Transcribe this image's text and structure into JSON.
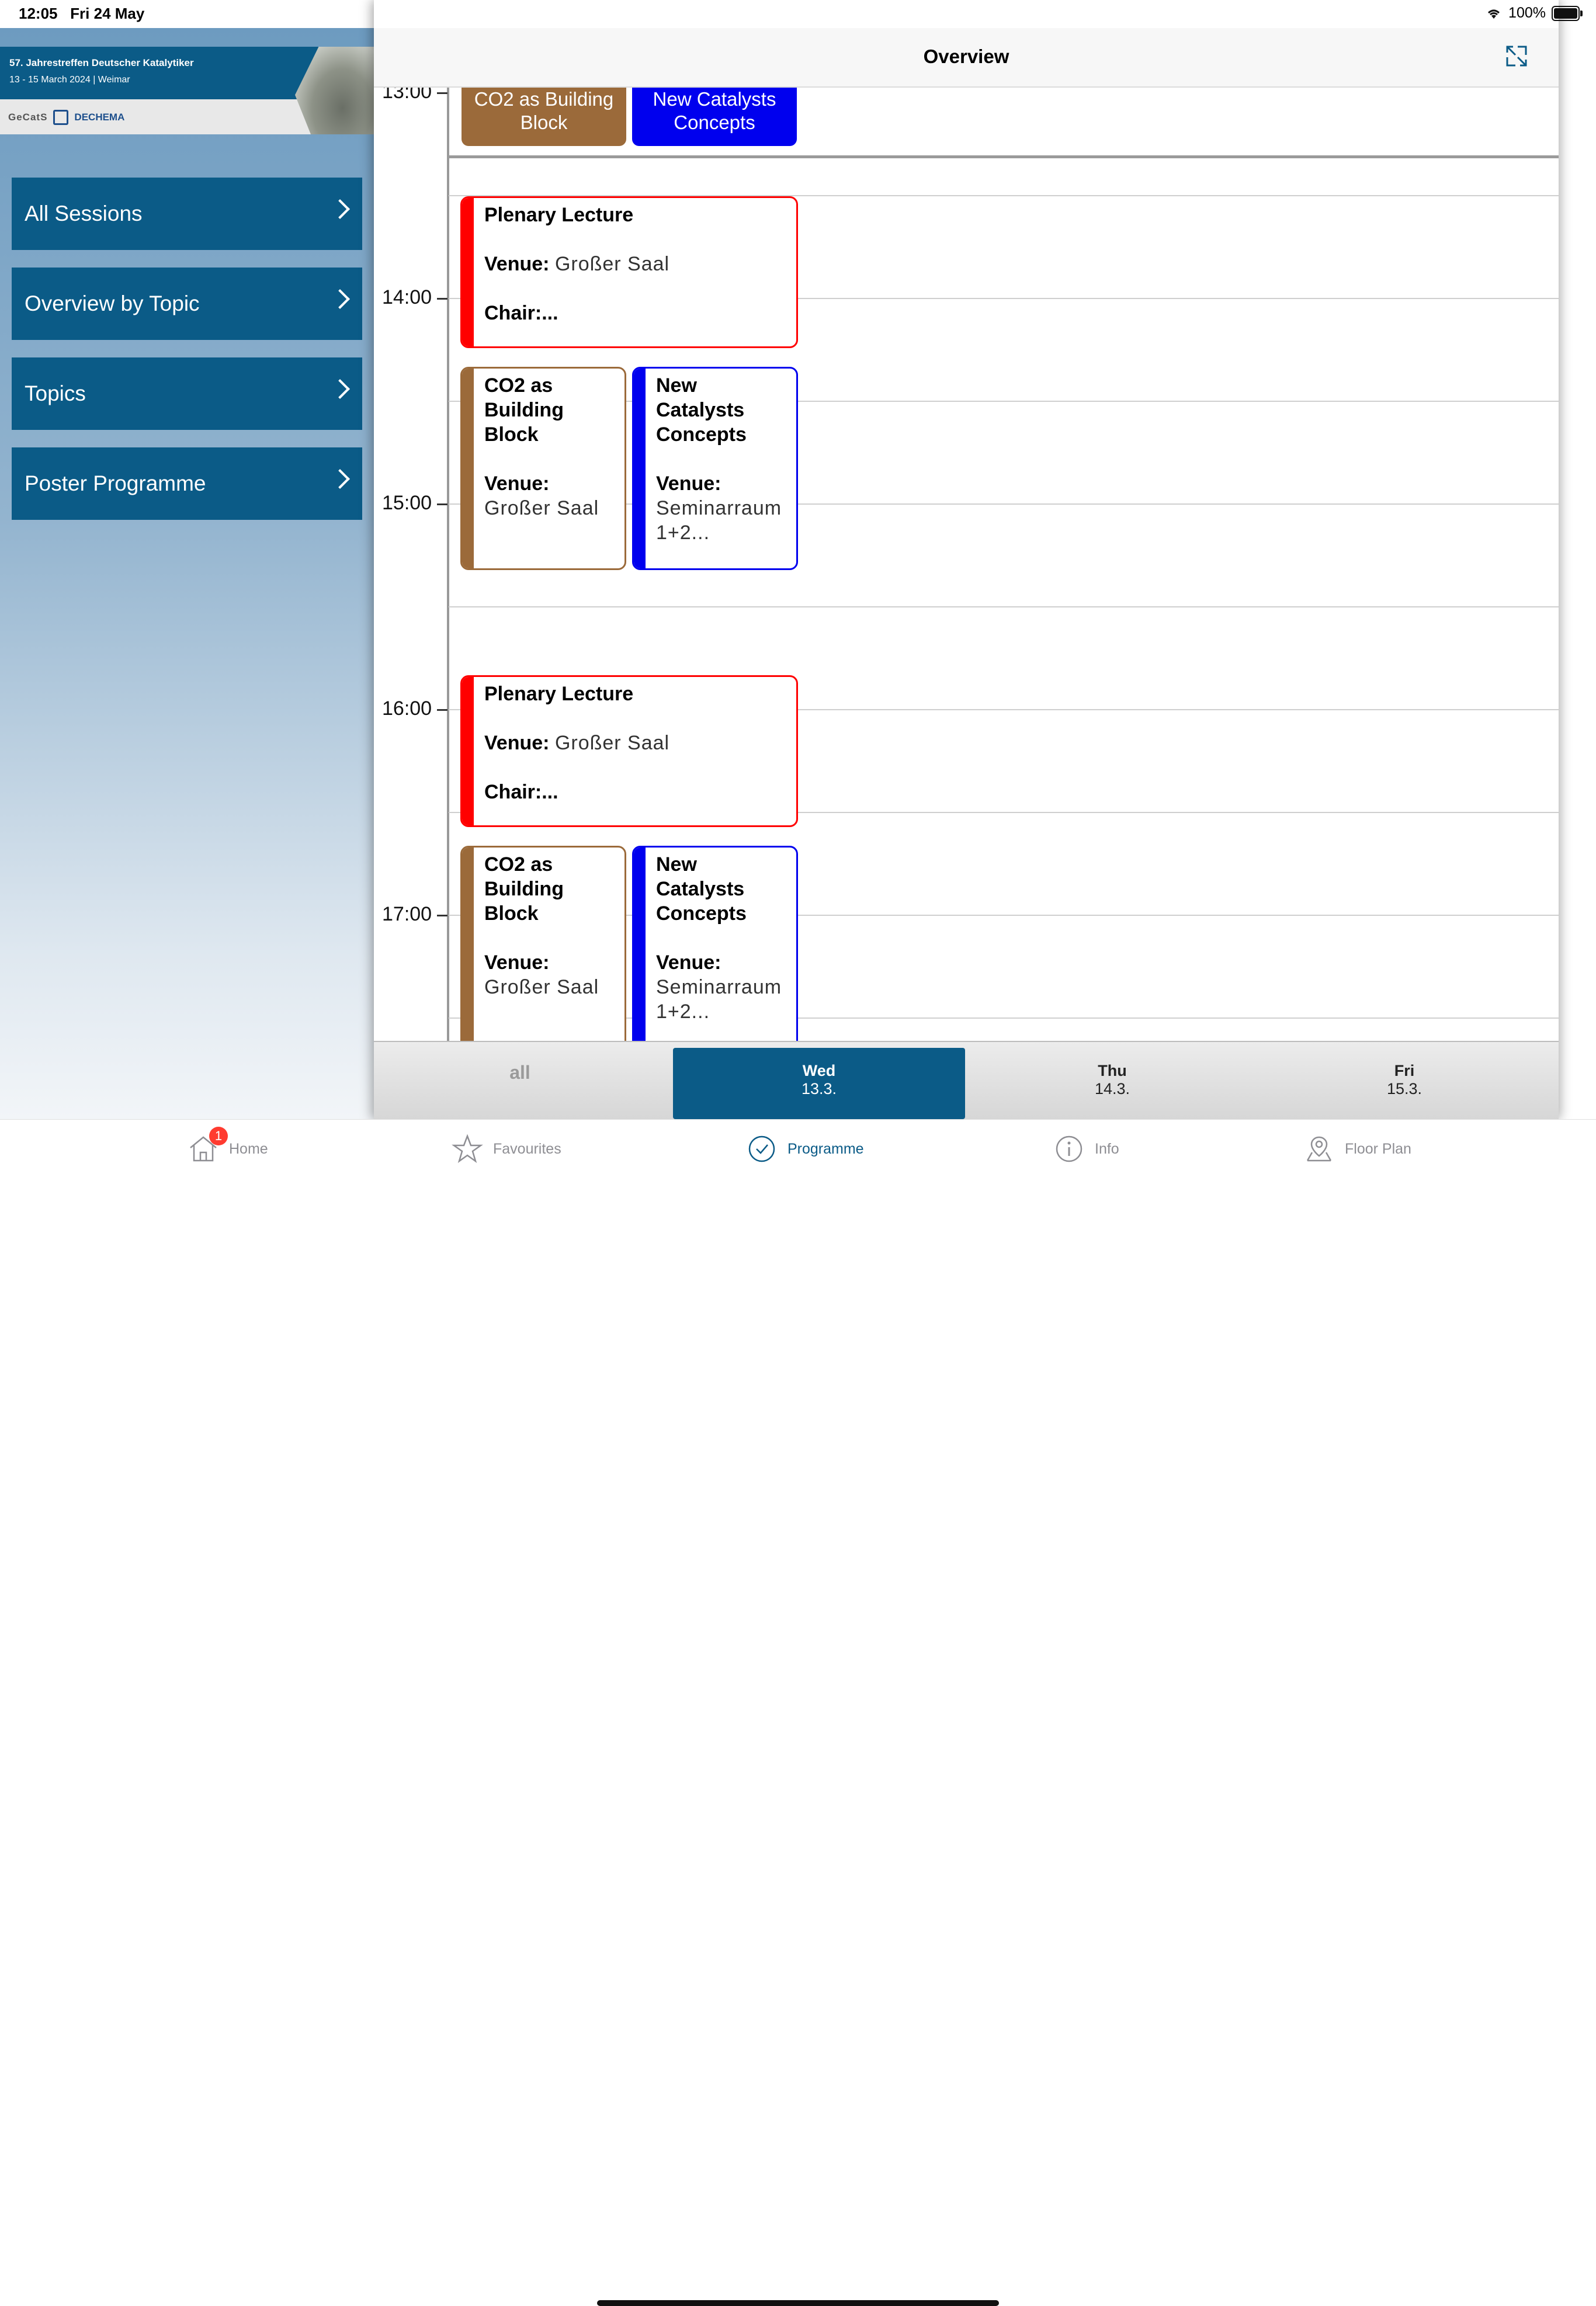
{
  "status_bar": {
    "time": "12:05",
    "date": "Fri 24 May",
    "battery": "100%"
  },
  "banner": {
    "title": "57. Jahrestreffen Deutscher Katalytiker",
    "subtitle": "13 - 15 March 2024 | Weimar",
    "logo_left": "GeCatS",
    "logo_right": "DECHEMA"
  },
  "sidebar": {
    "items": [
      {
        "label": "All Sessions"
      },
      {
        "label": "Overview by Topic"
      },
      {
        "label": "Topics"
      },
      {
        "label": "Poster Programme"
      }
    ]
  },
  "header": {
    "title": "Overview"
  },
  "schedule": {
    "times": [
      "13:00",
      "14:00",
      "15:00",
      "16:00",
      "17:00"
    ],
    "top_sessions": [
      {
        "title": "CO2 as Building Block",
        "color": "#9b6a3a"
      },
      {
        "title": "New Catalysts Concepts",
        "color": "#0000ee"
      }
    ],
    "venue_label": "Venue:",
    "chair_label": "Chair:...",
    "sessions": [
      {
        "title": "Plenary Lecture",
        "venue": "Großer Saal",
        "color": "#ff0000"
      },
      {
        "title": "CO2 as Building Block",
        "venue": "Großer Saal",
        "color": "#9b6a3a"
      },
      {
        "title": "New Catalysts Concepts",
        "venue": "Seminarraum 1+2...",
        "color": "#0000ee"
      },
      {
        "title": "Plenary Lecture",
        "venue": "Großer Saal",
        "color": "#ff0000"
      },
      {
        "title": "CO2 as Building Block",
        "venue": "Großer Saal",
        "color": "#9b6a3a"
      },
      {
        "title": "New Catalysts Concepts",
        "venue": "Seminarraum 1+2...",
        "color": "#0000ee"
      }
    ]
  },
  "days": [
    {
      "label": "all",
      "date": ""
    },
    {
      "label": "Wed",
      "date": "13.3.",
      "selected": true
    },
    {
      "label": "Thu",
      "date": "14.3."
    },
    {
      "label": "Fri",
      "date": "15.3."
    }
  ],
  "tabs": [
    {
      "label": "Home",
      "icon": "home-icon",
      "badge": "1"
    },
    {
      "label": "Favourites",
      "icon": "star-icon"
    },
    {
      "label": "Programme",
      "icon": "clock-icon",
      "active": true
    },
    {
      "label": "Info",
      "icon": "info-icon"
    },
    {
      "label": "Floor Plan",
      "icon": "map-pin-icon"
    }
  ]
}
